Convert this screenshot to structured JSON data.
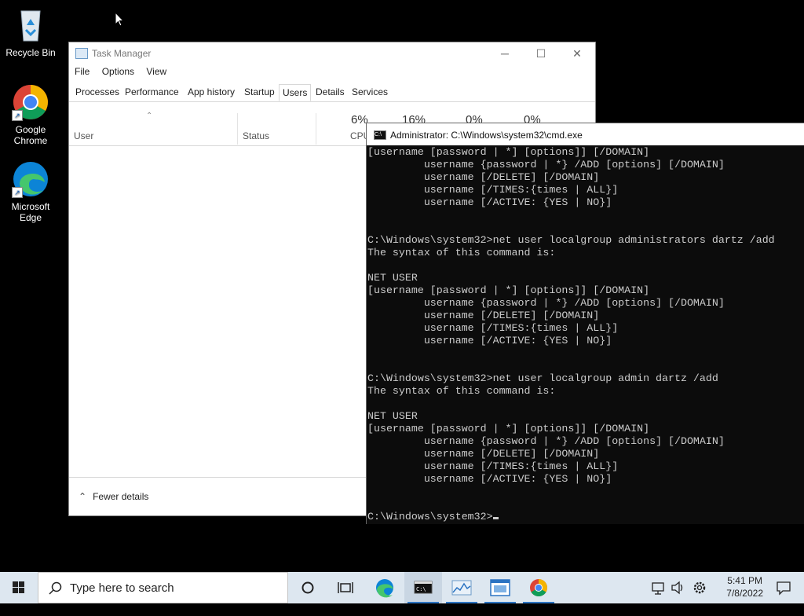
{
  "desktop": {
    "icons": [
      {
        "label": "Recycle Bin",
        "icon": "recycle-bin-icon"
      },
      {
        "label": "Google Chrome",
        "icon": "chrome-icon"
      },
      {
        "label": "Microsoft Edge",
        "icon": "edge-icon"
      }
    ]
  },
  "taskmgr": {
    "title": "Task Manager",
    "menu": [
      "File",
      "Options",
      "View"
    ],
    "tabs": [
      "Processes",
      "Performance",
      "App history",
      "Startup",
      "Users",
      "Details",
      "Services"
    ],
    "active_tab": "Users",
    "columns": {
      "user": "User",
      "status": "Status",
      "cpu": "CPU"
    },
    "percents": [
      "6%",
      "16%",
      "0%",
      "0%"
    ],
    "footer": "Fewer details"
  },
  "cmd": {
    "title": "Administrator: C:\\Windows\\system32\\cmd.exe",
    "lines": [
      "[username [password | *] [options]] [/DOMAIN]",
      "         username {password | *} /ADD [options] [/DOMAIN]",
      "         username [/DELETE] [/DOMAIN]",
      "         username [/TIMES:{times | ALL}]",
      "         username [/ACTIVE: {YES | NO}]",
      "",
      "",
      "C:\\Windows\\system32>net user localgroup administrators dartz /add",
      "The syntax of this command is:",
      "",
      "NET USER",
      "[username [password | *] [options]] [/DOMAIN]",
      "         username {password | *} /ADD [options] [/DOMAIN]",
      "         username [/DELETE] [/DOMAIN]",
      "         username [/TIMES:{times | ALL}]",
      "         username [/ACTIVE: {YES | NO}]",
      "",
      "",
      "C:\\Windows\\system32>net user localgroup admin dartz /add",
      "The syntax of this command is:",
      "",
      "NET USER",
      "[username [password | *] [options]] [/DOMAIN]",
      "         username {password | *} /ADD [options] [/DOMAIN]",
      "         username [/DELETE] [/DOMAIN]",
      "         username [/TIMES:{times | ALL}]",
      "         username [/ACTIVE: {YES | NO}]",
      "",
      ""
    ],
    "prompt": "C:\\Windows\\system32>"
  },
  "taskbar": {
    "search_placeholder": "Type here to search",
    "time": "5:41 PM",
    "date": "7/8/2022"
  },
  "colors": {
    "taskbar": "#dde7f0",
    "accent": "#2b73c2",
    "console_bg": "#0c0c0c"
  }
}
